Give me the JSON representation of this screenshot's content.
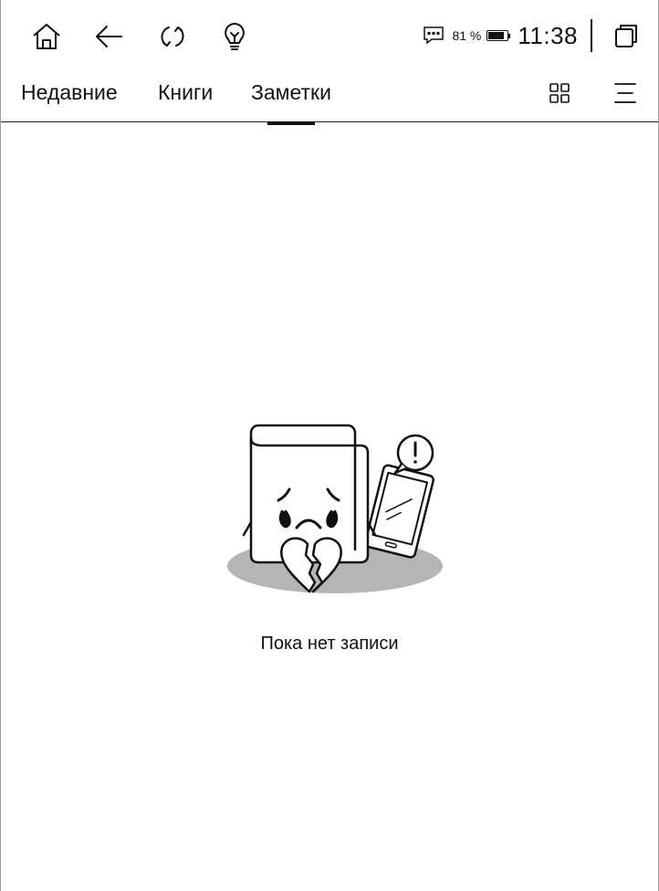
{
  "status_bar": {
    "icons": [
      "home-icon",
      "back-icon",
      "refresh-icon",
      "lightbulb-icon"
    ],
    "battery_percent_label": "81 %",
    "battery_level": 0.81,
    "time": "11:38"
  },
  "tabs": [
    {
      "label": "Недавние"
    },
    {
      "label": "Книги"
    },
    {
      "label": "Заметки",
      "active": true
    }
  ],
  "toolbar_icons": [
    "grid-view-icon",
    "menu-icon"
  ],
  "empty_state": {
    "message": "Пока нет записи",
    "illustration": "sad-broken-heart-book-icon"
  }
}
